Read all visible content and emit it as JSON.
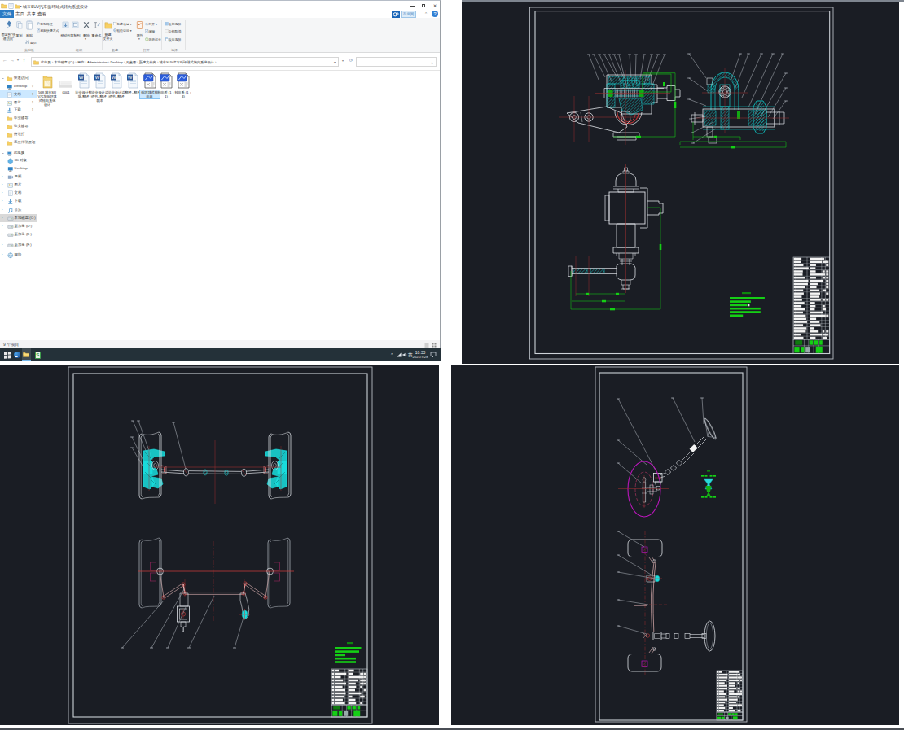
{
  "explorer": {
    "title": "城市SUV汽车循环球式转向系统设计",
    "tabs": {
      "file": "文件",
      "home": "主页",
      "share": "共享",
      "view": "查看"
    },
    "badge_label": "百度网盘",
    "ribbon": {
      "pin_line1": "固定到\"快",
      "pin_line2": "速访问\"",
      "copy": "复制",
      "paste": "粘贴",
      "cut": "剪切",
      "copy_path": "复制路径",
      "paste_shortcut": "粘贴快捷方式",
      "move_to": "移动到",
      "copy_to": "复制到",
      "delete": "删除",
      "rename": "重命名",
      "new_folder_line1": "新建",
      "new_folder_line2": "文件夹",
      "new_item": "新建项目",
      "easy_access": "轻松访问",
      "properties": "属性",
      "open": "打开",
      "edit": "编辑",
      "history": "历史记录",
      "select_all": "全部选择",
      "select_none": "全部取消",
      "invert_selection": "反向选择",
      "group_clipboard": "剪贴板",
      "group_organize": "组织",
      "group_new": "新建",
      "group_open": "打开",
      "group_select": "选择"
    },
    "breadcrumb": [
      "此电脑",
      "本地磁盘 (C:)",
      "用户",
      "Administrator",
      "Desktop",
      "凡素图",
      "新建文件夹",
      "城市SUV汽车循环球式转向系统设计"
    ],
    "sidebar": {
      "quick_access": "快速访问",
      "quick_items": [
        {
          "label": "Desktop",
          "icon": "desktop",
          "pinned": true
        },
        {
          "label": "文档",
          "icon": "doc",
          "pinned": true,
          "selected": true
        },
        {
          "label": "图片",
          "icon": "pic",
          "pinned": true
        },
        {
          "label": "下载",
          "icon": "down",
          "pinned": true
        },
        {
          "label": "毕业辅导",
          "icon": "folder"
        },
        {
          "label": "论文辅导",
          "icon": "folder"
        },
        {
          "label": "待送打",
          "icon": "folder"
        },
        {
          "label": "液压传动原理",
          "icon": "folder"
        }
      ],
      "this_pc": "此电脑",
      "pc_items": [
        {
          "label": "3D 对象",
          "icon": "3d"
        },
        {
          "label": "Desktop",
          "icon": "desktop"
        },
        {
          "label": "视频",
          "icon": "video"
        },
        {
          "label": "图片",
          "icon": "pic"
        },
        {
          "label": "文档",
          "icon": "doc"
        },
        {
          "label": "下载",
          "icon": "down"
        },
        {
          "label": "音乐",
          "icon": "music"
        },
        {
          "label": "本地磁盘 (C:)",
          "icon": "disk",
          "selected": true
        },
        {
          "label": "新加卷 (D:)",
          "icon": "disk"
        },
        {
          "label": "新加卷 (E:)",
          "icon": "disk"
        }
      ],
      "extra_drive": "新加卷 (F:)",
      "network": "网络"
    },
    "files": [
      {
        "name": "568 城市SUV汽车循环球式转向系统设计",
        "type": "folder"
      },
      {
        "name": "0001",
        "type": "blank"
      },
      {
        "name": "毕业设计数据-翻译",
        "type": "word"
      },
      {
        "name": "毕业设计说明书--翻译 - 副本",
        "type": "word"
      },
      {
        "name": "毕业设计说明书--翻译",
        "type": "word"
      },
      {
        "name": "翻译--翻译",
        "type": "word"
      },
      {
        "name": "循环球式转向器",
        "type": "dwg",
        "selected": true
      },
      {
        "name": "转向桥 (1：1)",
        "type": "dwg"
      },
      {
        "name": "转向系 (1：4)",
        "type": "dwg"
      }
    ],
    "statusbar": {
      "item_count": "9 个项目"
    },
    "taskbar": {
      "ime": "英",
      "time": "10:33",
      "date": "2021/7/28"
    }
  }
}
